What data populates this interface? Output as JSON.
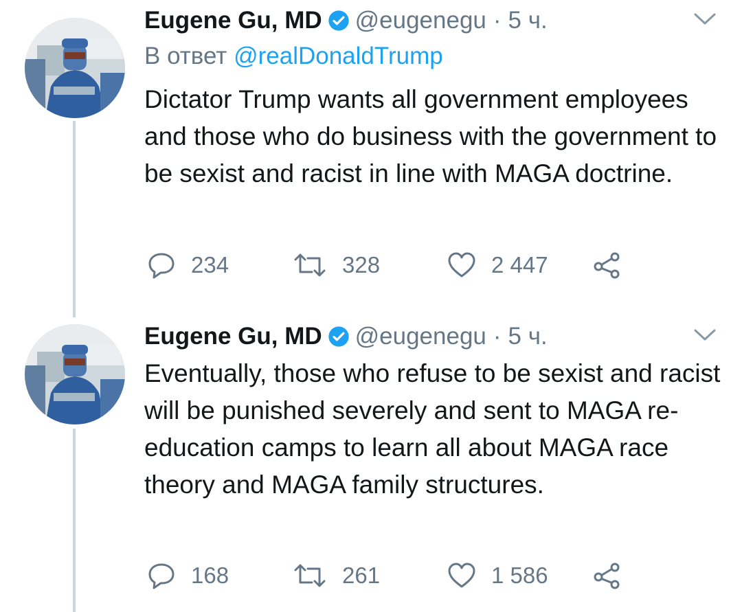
{
  "tweets": [
    {
      "author_name": "Eugene Gu, MD",
      "handle": "@eugenegu",
      "separator": "·",
      "time": "5 ч.",
      "reply_prefix": "В ответ",
      "reply_to": "@realDonaldTrump",
      "text": "Dictator Trump wants all government employees and those who do business with the government to be sexist and racist in line with MAGA doctrine.",
      "replies": "234",
      "retweets": "328",
      "likes": "2 447"
    },
    {
      "author_name": "Eugene Gu, MD",
      "handle": "@eugenegu",
      "separator": "·",
      "time": "5 ч.",
      "text": "Eventually, those who refuse to be sexist and racist will be punished severely and sent to MAGA re-education camps to learn all about MAGA race theory and MAGA family structures.",
      "replies": "168",
      "retweets": "261",
      "likes": "1 586"
    }
  ],
  "icons": {
    "reply": "reply-icon",
    "retweet": "retweet-icon",
    "like": "heart-icon",
    "share": "share-icon",
    "verified": "verified-badge-icon",
    "menu": "chevron-down-icon"
  },
  "colors": {
    "text": "#14171a",
    "secondary": "#657786",
    "link": "#1da1f2",
    "verified": "#1da1f2",
    "thread_line": "#ccd6dd"
  }
}
